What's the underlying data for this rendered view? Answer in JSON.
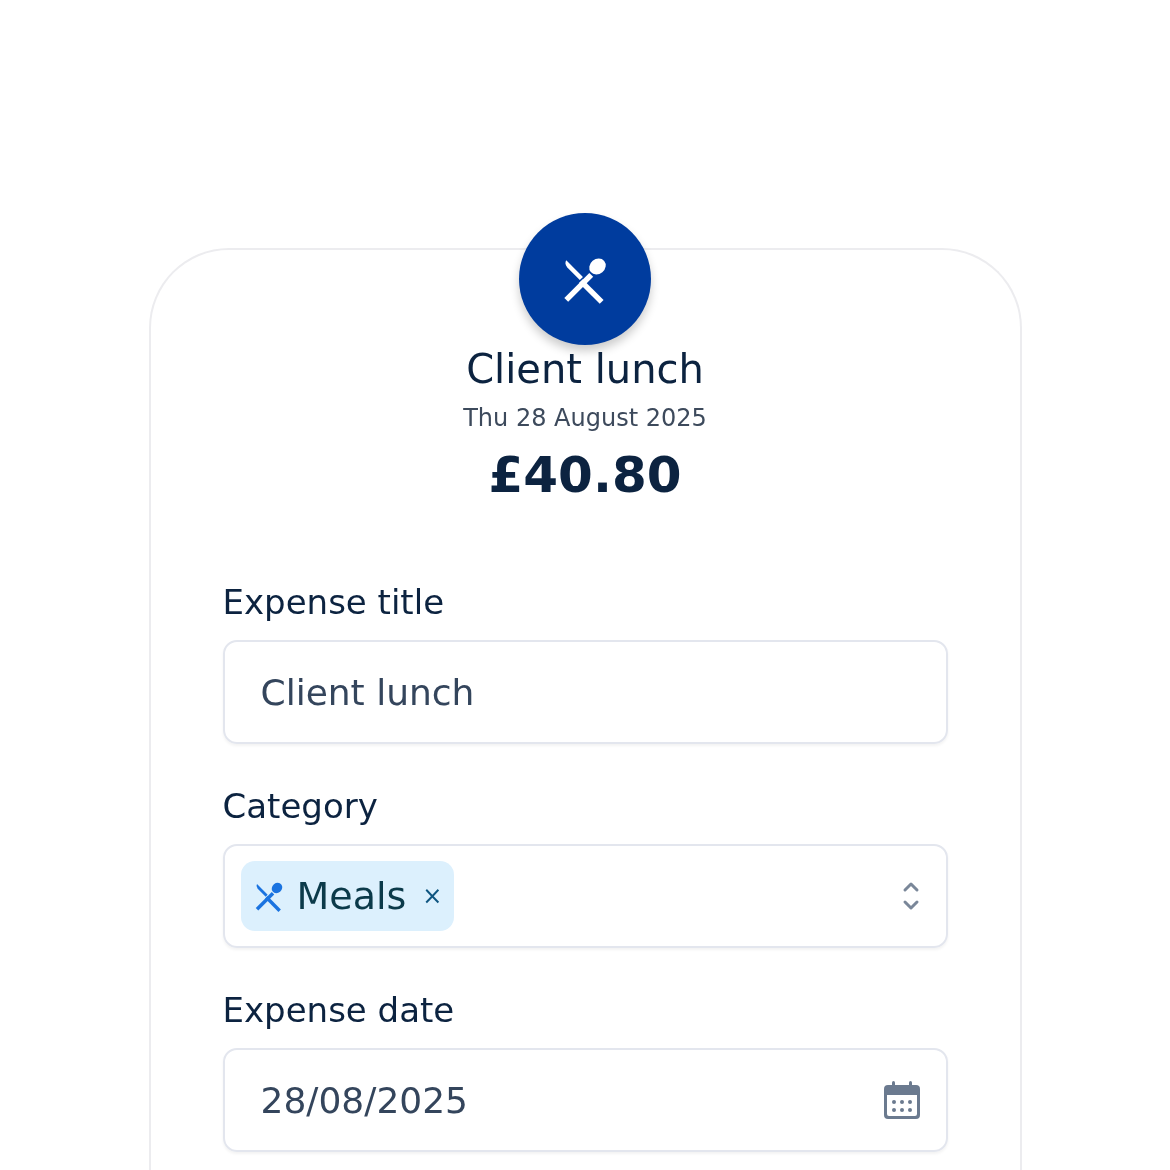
{
  "header": {
    "title": "Client lunch",
    "date": "Thu 28 August 2025",
    "amount": "£40.80"
  },
  "fields": [
    {
      "kind": "text",
      "label": "Expense title",
      "value": "Client lunch"
    },
    {
      "kind": "tags",
      "label": "Category",
      "tags": [
        {
          "label": "Meals",
          "remove": "×"
        }
      ]
    },
    {
      "kind": "date",
      "label": "Expense date",
      "value": "28/08/2025"
    }
  ]
}
